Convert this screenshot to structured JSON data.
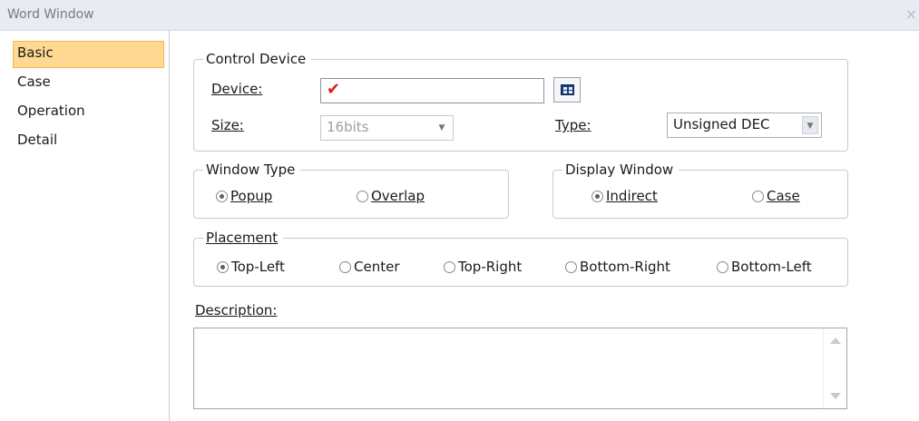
{
  "window": {
    "title": "Word Window",
    "close_glyph": "×"
  },
  "sidebar": {
    "items": [
      {
        "label": "Basic",
        "selected": true
      },
      {
        "label": "Case",
        "selected": false
      },
      {
        "label": "Operation",
        "selected": false
      },
      {
        "label": "Detail",
        "selected": false
      }
    ]
  },
  "control_device": {
    "legend": "Control Device",
    "device_label": "Device:",
    "device_value": "✔",
    "browse_icon": "device-browse-icon",
    "size_label": "Size:",
    "size_value": "16bits",
    "type_label": "Type:",
    "type_value": "Unsigned DEC"
  },
  "window_type": {
    "legend": "Window Type",
    "options": [
      {
        "label": "Popup",
        "checked": true
      },
      {
        "label": "Overlap",
        "checked": false
      }
    ]
  },
  "display_window": {
    "legend": "Display Window",
    "options": [
      {
        "label": "Indirect",
        "checked": true
      },
      {
        "label": "Case",
        "checked": false
      }
    ]
  },
  "placement": {
    "legend": "Placement",
    "options": [
      {
        "label": "Top-Left",
        "checked": true
      },
      {
        "label": "Center",
        "checked": false
      },
      {
        "label": "Top-Right",
        "checked": false
      },
      {
        "label": "Bottom-Right",
        "checked": false
      },
      {
        "label": "Bottom-Left",
        "checked": false
      }
    ]
  },
  "description": {
    "label": "Description:",
    "value": ""
  },
  "colors": {
    "selected_item_bg": "#ffd991",
    "checkmark": "#e01b1b",
    "titlebar_bg": "#e8ebf2"
  }
}
